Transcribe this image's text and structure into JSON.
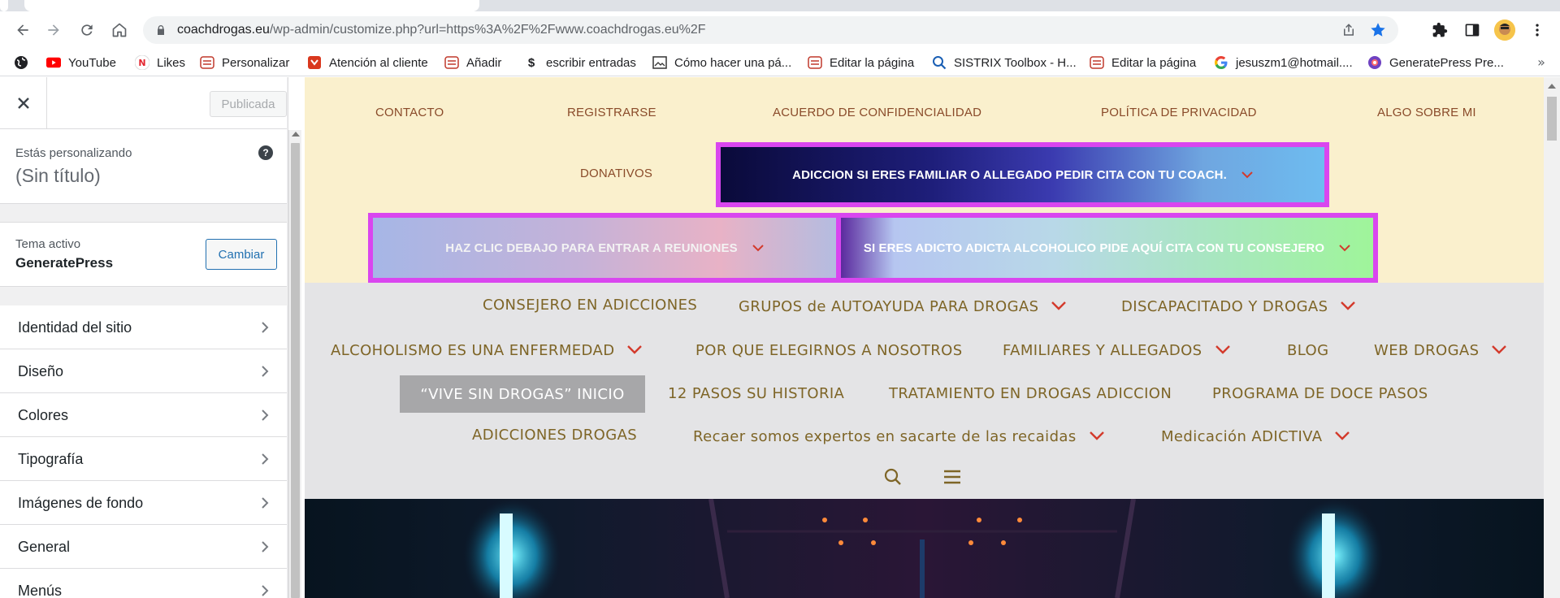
{
  "browser": {
    "url": {
      "host": "coachdrogas.eu",
      "path": "/wp-admin/customize.php?url=https%3A%2F%2Fwww.coachdrogas.eu%2F"
    },
    "bookmarks": [
      {
        "label": "",
        "icon": "globe-icon"
      },
      {
        "label": "YouTube",
        "icon": "youtube-icon"
      },
      {
        "label": "Likes",
        "icon": "n-logo-icon"
      },
      {
        "label": "Personalizar",
        "icon": "site-favicon-icon"
      },
      {
        "label": "Atención al cliente",
        "icon": "shield-favicon-icon"
      },
      {
        "label": "Añadir",
        "icon": "site-favicon-icon"
      },
      {
        "label": "escribir entradas",
        "icon": "dollar-icon"
      },
      {
        "label": "Cómo hacer una pá...",
        "icon": "image-icon"
      },
      {
        "label": "Editar la página",
        "icon": "site-favicon-icon"
      },
      {
        "label": "SISTRIX Toolbox - H...",
        "icon": "magnifier-icon"
      },
      {
        "label": "Editar la página",
        "icon": "site-favicon-icon"
      },
      {
        "label": "jesuszm1@hotmail....",
        "icon": "google-icon"
      },
      {
        "label": "GeneratePress Pre...",
        "icon": "generatepress-icon"
      }
    ]
  },
  "sidebar": {
    "publish_label": "Publicada",
    "customizing_label": "Estás personalizando",
    "site_title": "(Sin título)",
    "active_theme_label": "Tema activo",
    "theme_name": "GeneratePress",
    "change_label": "Cambiar",
    "menu": [
      {
        "label": "Identidad del sitio"
      },
      {
        "label": "Diseño"
      },
      {
        "label": "Colores"
      },
      {
        "label": "Tipografía"
      },
      {
        "label": "Imágenes de fondo"
      },
      {
        "label": "General"
      },
      {
        "label": "Menús"
      }
    ]
  },
  "preview": {
    "secondary_nav": {
      "items": [
        "CONTACTO",
        "REGISTRARSE",
        "ACUERDO DE CONFIDENCIALIDAD",
        "POLÍTICA DE PRIVACIDAD",
        "ALGO SOBRE MI",
        "DONATIVOS"
      ],
      "highlight_1": "ADICCION SI ERES FAMILIAR O ALLEGADO PEDIR CITA CON TU COACH.",
      "highlight_2": "HAZ CLIC DEBAJO PARA ENTRAR A REUNIONES",
      "highlight_3": "SI ERES ADICTO ADICTA ALCOHOLICO PIDE AQUÍ CITA CON TU CONSEJERO"
    },
    "primary_nav": {
      "items": [
        "CONSEJERO EN ADICCIONES",
        "GRUPOS de AUTOAYUDA PARA DROGAS",
        "DISCAPACITADO Y DROGAS",
        "ALCOHOLISMO ES UNA ENFERMEDAD",
        "POR QUE ELEGIRNOS A NOSOTROS",
        "FAMILIARES Y ALLEGADOS",
        "BLOG",
        "WEB DROGAS",
        "“VIVE SIN DROGAS” INICIO",
        "12 PASOS SU HISTORIA",
        "TRATAMIENTO EN DROGAS ADICCION",
        "PROGRAMA DE DOCE PASOS",
        "ADICCIONES DROGAS",
        "Recaer somos expertos en sacarte de las recaidas",
        "Medicación ADICTIVA"
      ]
    }
  },
  "colors": {
    "highlight_border": "#d946ef",
    "secondary_bg": "#faf0cd",
    "primary_bg": "#e4e4e6",
    "secondary_text": "#8a4b2a",
    "primary_text": "#7e6527",
    "dropdown_arrow": "#d33a2c",
    "current_item_bg": "#a7a7a9"
  }
}
